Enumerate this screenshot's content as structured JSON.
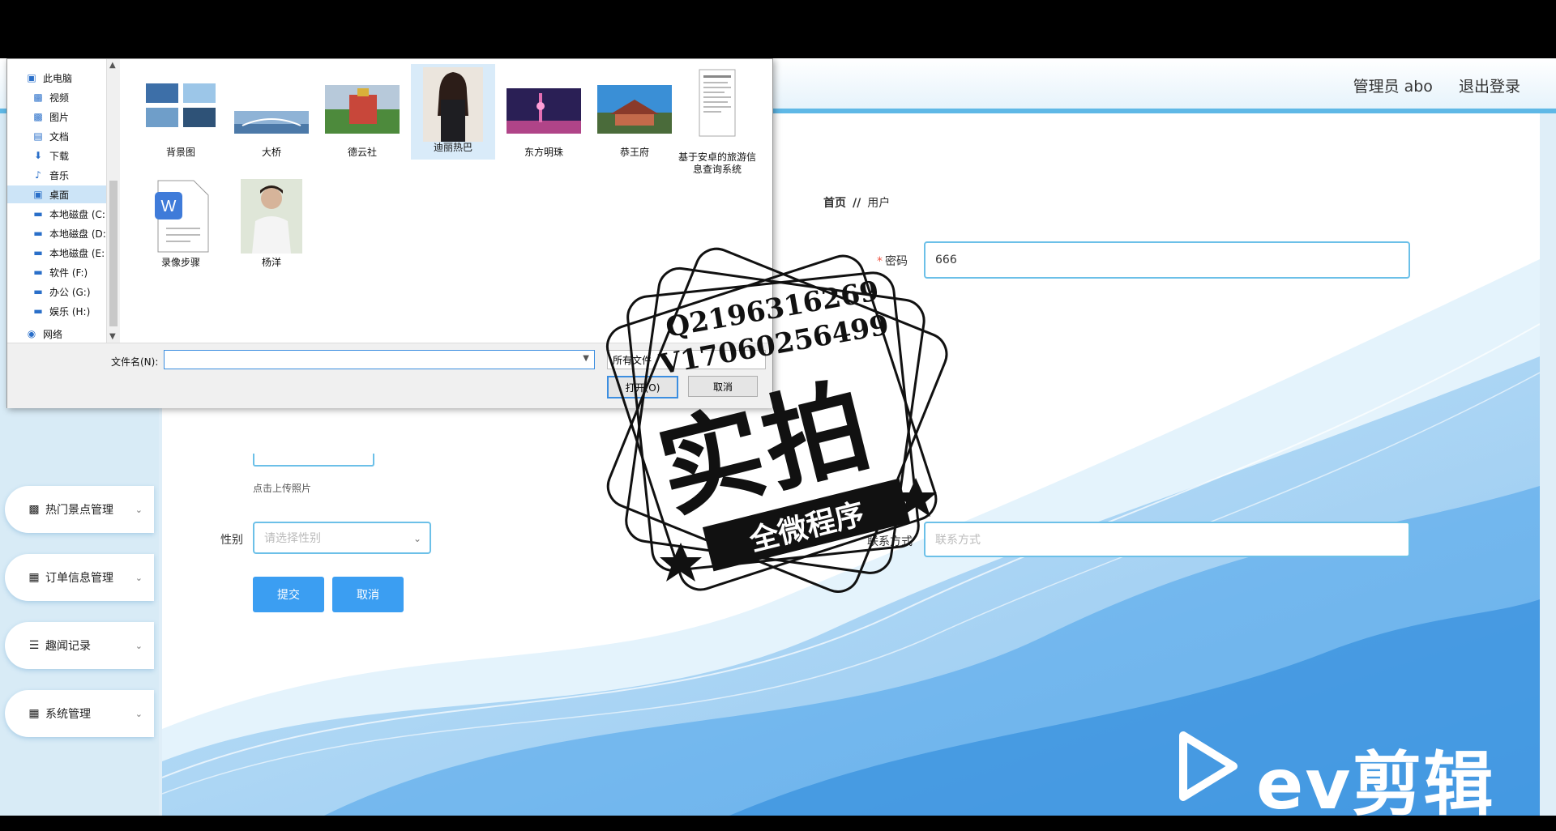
{
  "header": {
    "admin": "管理员 abo",
    "logout": "退出登录"
  },
  "sidebar": {
    "items": [
      {
        "label": "热门景点管理",
        "icon": "clipboard-icon"
      },
      {
        "label": "订单信息管理",
        "icon": "grid-icon"
      },
      {
        "label": "趣闻记录",
        "icon": "list-icon"
      },
      {
        "label": "系统管理",
        "icon": "grid-icon"
      }
    ]
  },
  "breadcrumb": {
    "home": "首页",
    "sep": "//",
    "current": "用户"
  },
  "form": {
    "password_label": "密码",
    "password_required": "*",
    "password_value": "666",
    "upload_tip": "点击上传照片",
    "gender_label": "性别",
    "gender_placeholder": "请选择性别",
    "contact_label": "联系方式",
    "contact_placeholder": "联系方式",
    "submit": "提交",
    "cancel": "取消"
  },
  "dialog": {
    "tree": [
      {
        "label": "此电脑",
        "icon": "computer-icon"
      },
      {
        "label": "视频",
        "icon": "video-icon"
      },
      {
        "label": "图片",
        "icon": "picture-icon"
      },
      {
        "label": "文档",
        "icon": "document-icon"
      },
      {
        "label": "下载",
        "icon": "download-icon"
      },
      {
        "label": "音乐",
        "icon": "music-icon"
      },
      {
        "label": "桌面",
        "icon": "desktop-icon",
        "selected": true
      },
      {
        "label": "本地磁盘 (C:",
        "icon": "drive-icon"
      },
      {
        "label": "本地磁盘 (D:",
        "icon": "drive-icon"
      },
      {
        "label": "本地磁盘 (E:",
        "icon": "drive-icon"
      },
      {
        "label": "软件 (F:)",
        "icon": "drive-icon"
      },
      {
        "label": "办公 (G:)",
        "icon": "drive-icon"
      },
      {
        "label": "娱乐 (H:)",
        "icon": "drive-icon"
      },
      {
        "label": "网络",
        "icon": "network-icon"
      }
    ],
    "files": [
      {
        "name": "背景图"
      },
      {
        "name": "大桥"
      },
      {
        "name": "德云社"
      },
      {
        "name": "迪丽热巴",
        "selected": true
      },
      {
        "name": "东方明珠"
      },
      {
        "name": "恭王府"
      },
      {
        "name": "基于安卓的旅游信息查询系统"
      },
      {
        "name": "录像步骤"
      },
      {
        "name": "杨洋"
      }
    ],
    "filename_label": "文件名(N):",
    "filename_value": "",
    "filter": "所有文件",
    "open": "打开(O)",
    "cancel": "取消"
  },
  "stamp": {
    "line1": "Q2196316269",
    "line2": "V17060256499",
    "big": "实拍",
    "ribbon": "全微程序"
  },
  "watermark": "ev剪辑",
  "colors": {
    "accent": "#3b9ef2",
    "input_border": "#6cc0e8",
    "sidebar_bg": "#d8ebf6"
  }
}
